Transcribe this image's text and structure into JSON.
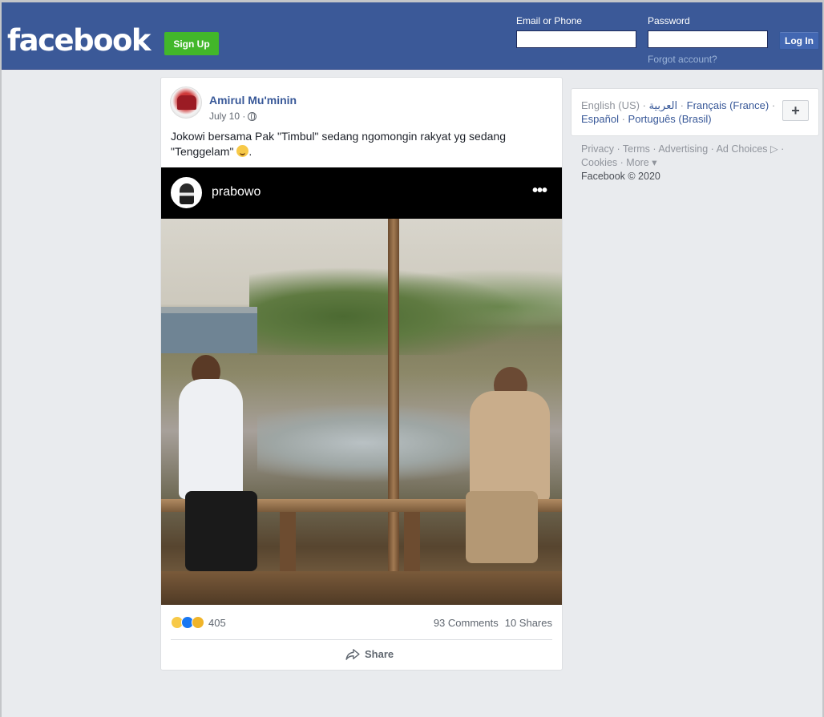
{
  "header": {
    "logo": "facebook",
    "signup_label": "Sign Up",
    "email_label": "Email or Phone",
    "password_label": "Password",
    "login_label": "Log In",
    "forgot_label": "Forgot account?"
  },
  "post": {
    "author": "Amirul Mu'minin",
    "date": "July 10 · ",
    "text": "Jokowi bersama Pak \"Timbul\" sedang ngomongin rakyat yg sedang \"Tenggelam\" ",
    "text_end": ".",
    "embed": {
      "account": "prabowo",
      "menu_dots": "•••"
    },
    "reaction_count": "405",
    "comments": "93 Comments",
    "shares": "10 Shares",
    "share_label": "Share"
  },
  "languages": {
    "current": "English (US)",
    "items": [
      "العربية",
      "Français (France)",
      "Español",
      "Português (Brasil)"
    ],
    "more": "+"
  },
  "footer": {
    "links": [
      "Privacy",
      "Terms",
      "Advertising",
      "Ad Choices",
      "Cookies",
      "More"
    ],
    "copyright": "Facebook © 2020"
  },
  "colors": {
    "brand": "#3b5998",
    "signup_green": "#42b72a",
    "link": "#385898"
  }
}
